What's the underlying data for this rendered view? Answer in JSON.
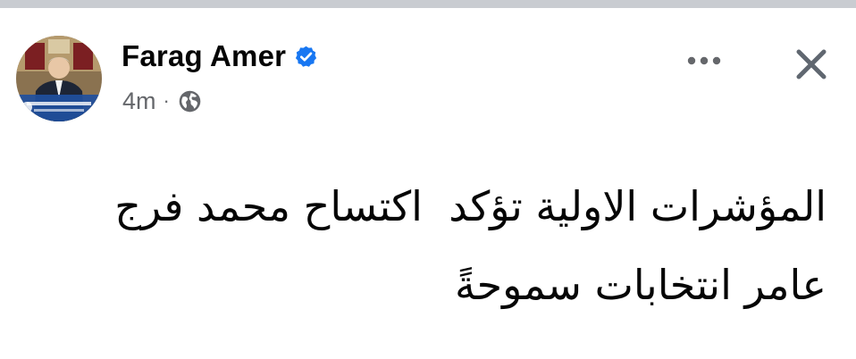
{
  "post": {
    "author": {
      "name": "Farag Amer",
      "verified_icon": "verified-badge-icon",
      "avatar_icon": "profile-photo"
    },
    "meta": {
      "time": "4m",
      "separator": "·",
      "privacy_icon": "globe-icon"
    },
    "actions": {
      "more_icon": "more-options-icon",
      "close_icon": "close-icon"
    },
    "text_lines": [
      "المؤشرات الاولية تؤكد  اكتساح محمد فرج",
      "عامر انتخابات سموحةً"
    ]
  },
  "colors": {
    "verified_blue": "#1877f2",
    "secondary_text": "#65676b",
    "primary_text": "#050505",
    "top_strip": "#c9ccd1"
  }
}
